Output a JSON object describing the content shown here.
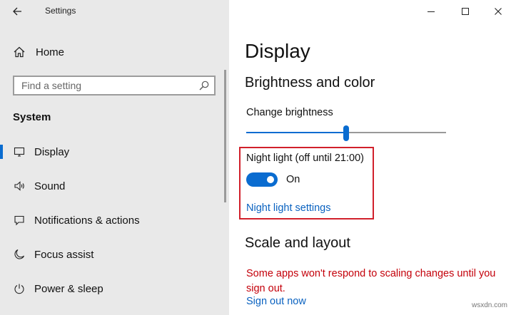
{
  "window": {
    "title": "Settings"
  },
  "sidebar": {
    "home_label": "Home",
    "search_placeholder": "Find a setting",
    "section_heading": "System",
    "items": [
      {
        "label": "Display",
        "icon": "monitor-icon",
        "selected": true
      },
      {
        "label": "Sound",
        "icon": "speaker-icon",
        "selected": false
      },
      {
        "label": "Notifications & actions",
        "icon": "notification-icon",
        "selected": false
      },
      {
        "label": "Focus assist",
        "icon": "moon-icon",
        "selected": false
      },
      {
        "label": "Power & sleep",
        "icon": "power-icon",
        "selected": false
      }
    ]
  },
  "main": {
    "title": "Display",
    "brightness_section": "Brightness and color",
    "brightness_label": "Change brightness",
    "brightness_value": 50,
    "night_light_label": "Night light (off until 21:00)",
    "night_light_state": "On",
    "night_light_link": "Night light settings",
    "scale_section": "Scale and layout",
    "scale_warning": "Some apps won't respond to scaling changes until you sign out.",
    "sign_out_link": "Sign out now"
  },
  "watermark": "wsxdn.com",
  "colors": {
    "accent": "#0a6cd0",
    "highlight": "#d1202b",
    "warning": "#c4000a",
    "sidebar_bg": "#e9e9e9"
  }
}
